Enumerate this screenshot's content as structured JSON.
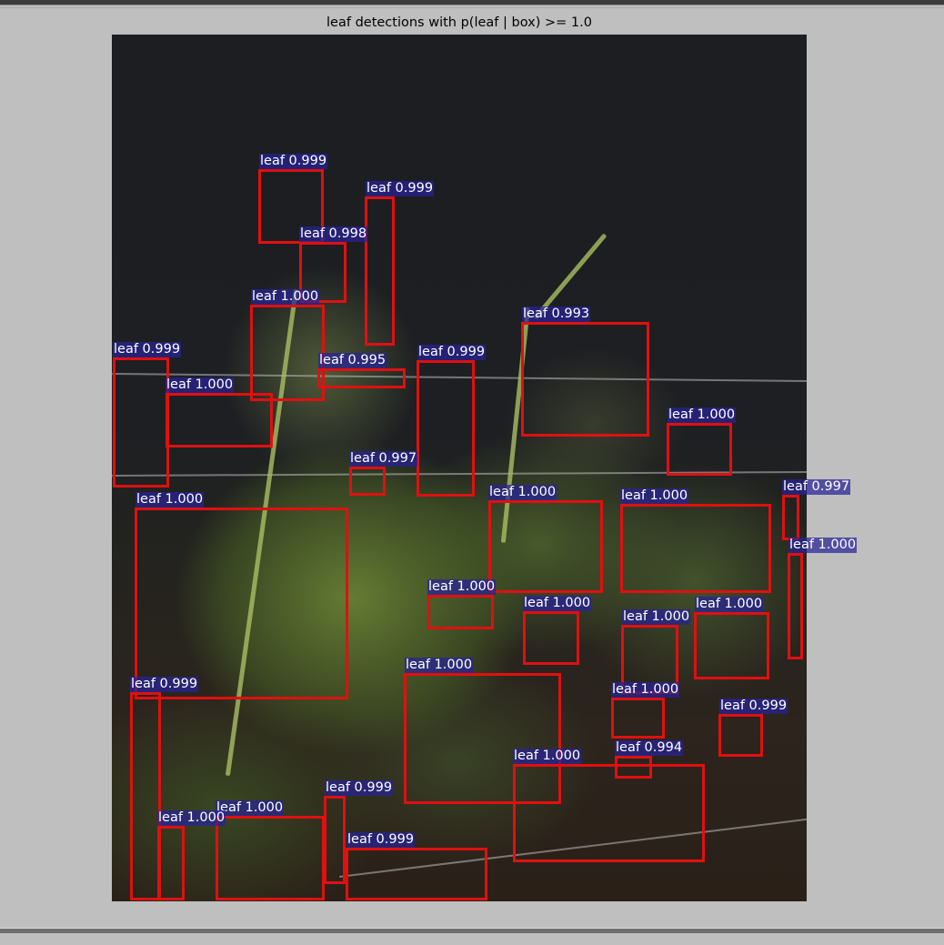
{
  "figure": {
    "title": "leaf detections with p(leaf | box) >= 1.0"
  },
  "detections": [
    {
      "label": "leaf 0.999"
    },
    {
      "label": "leaf 0.999"
    },
    {
      "label": "leaf 0.998"
    },
    {
      "label": "leaf 1.000"
    },
    {
      "label": "leaf 0.999"
    },
    {
      "label": "leaf 1.000"
    },
    {
      "label": "leaf 0.995"
    },
    {
      "label": "leaf 0.999"
    },
    {
      "label": "leaf 0.993"
    },
    {
      "label": "leaf 1.000"
    },
    {
      "label": "leaf 0.997"
    },
    {
      "label": "leaf 1.000"
    },
    {
      "label": "leaf 1.000"
    },
    {
      "label": "leaf 1.000"
    },
    {
      "label": "leaf 0.997"
    },
    {
      "label": "leaf 1.000"
    },
    {
      "label": "leaf 1.000"
    },
    {
      "label": "leaf 1.000"
    },
    {
      "label": "leaf 1.000"
    },
    {
      "label": "leaf 1.000"
    },
    {
      "label": "leaf 0.999"
    },
    {
      "label": "leaf 1.000"
    },
    {
      "label": "leaf 1.000"
    },
    {
      "label": "leaf 0.999"
    },
    {
      "label": "leaf 0.994"
    },
    {
      "label": "leaf 1.000"
    },
    {
      "label": "leaf 0.999"
    },
    {
      "label": "leaf 1.000"
    },
    {
      "label": "leaf 1.000"
    },
    {
      "label": "leaf 0.999"
    }
  ],
  "colors": {
    "box_edge": "#e01010",
    "label_background": "#28229a",
    "label_text": "#ffffff",
    "figure_background": "#bfbfbf"
  }
}
